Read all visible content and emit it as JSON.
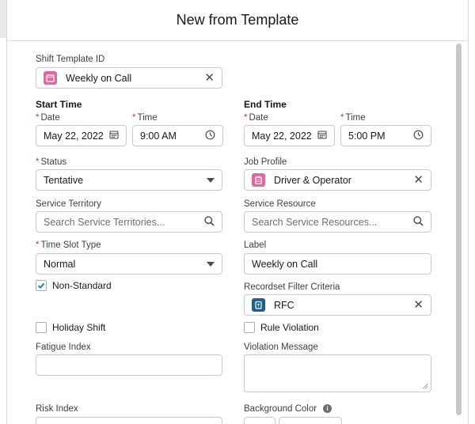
{
  "modal": {
    "title": "New from Template"
  },
  "form": {
    "shift_template": {
      "label": "Shift Template ID",
      "value": "Weekly on Call",
      "icon": "calendar-icon"
    },
    "start_time": {
      "title": "Start Time",
      "date_label": "Date",
      "date_value": "May 22, 2022",
      "time_label": "Time",
      "time_value": "9:00 AM"
    },
    "end_time": {
      "title": "End Time",
      "date_label": "Date",
      "date_value": "May 22, 2022",
      "time_label": "Time",
      "time_value": "5:00 PM"
    },
    "status": {
      "label": "Status",
      "value": "Tentative"
    },
    "job_profile": {
      "label": "Job Profile",
      "value": "Driver & Operator",
      "icon": "clipboard-icon"
    },
    "service_territory": {
      "label": "Service Territory",
      "placeholder": "Search Service Territories..."
    },
    "service_resource": {
      "label": "Service Resource",
      "placeholder": "Search Service Resources..."
    },
    "time_slot_type": {
      "label": "Time Slot Type",
      "value": "Normal"
    },
    "label_field": {
      "label": "Label",
      "value": "Weekly on Call"
    },
    "non_standard": {
      "label": "Non-Standard",
      "checked": true
    },
    "recordset_filter": {
      "label": "Recordset Filter Criteria",
      "value": "RFC",
      "icon": "filter-icon"
    },
    "holiday_shift": {
      "label": "Holiday Shift",
      "checked": false
    },
    "rule_violation": {
      "label": "Rule Violation",
      "checked": false
    },
    "fatigue_index": {
      "label": "Fatigue Index",
      "value": ""
    },
    "violation_message": {
      "label": "Violation Message",
      "value": ""
    },
    "risk_index": {
      "label": "Risk Index"
    },
    "background_color": {
      "label": "Background Color"
    }
  },
  "colors": {
    "required": "#c23934",
    "checkbox_check": "#0176d3",
    "pink_icon": "#e3669f",
    "teal_icon": "#1e5f8c"
  }
}
